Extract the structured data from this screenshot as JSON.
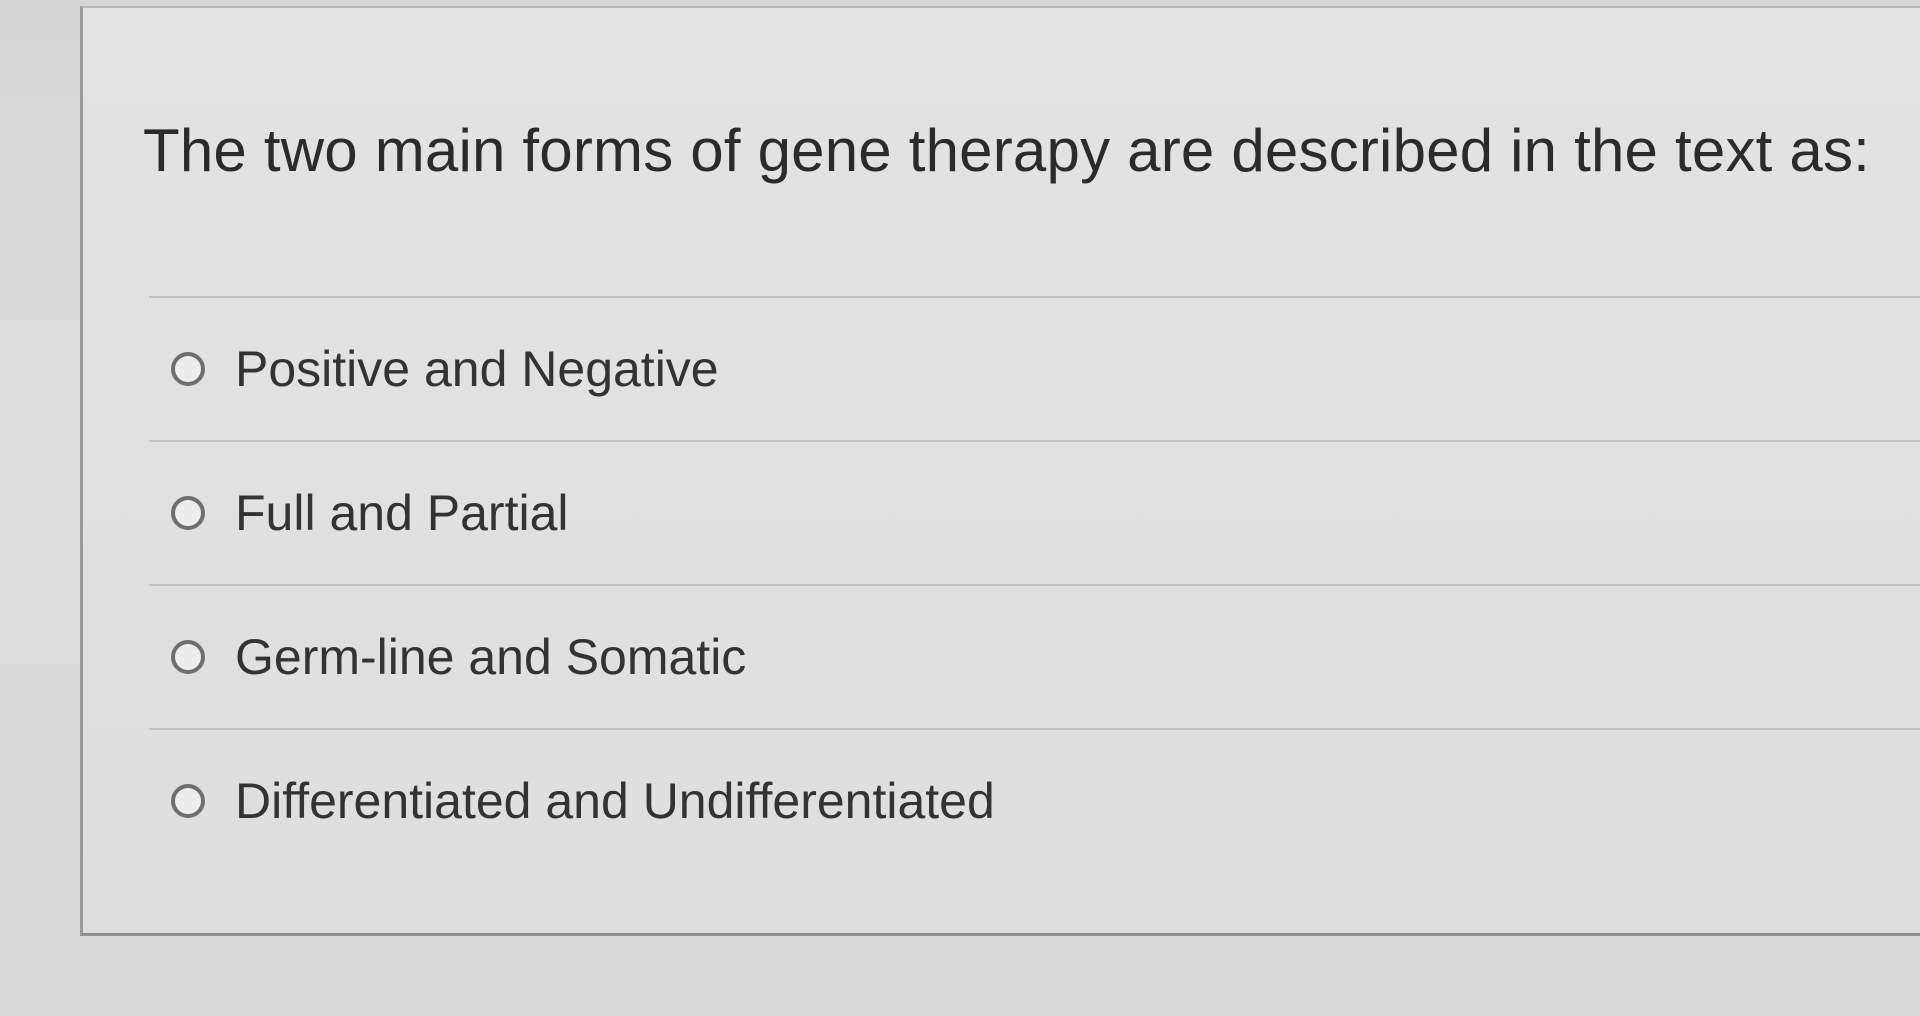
{
  "question": {
    "text": "The two main forms of gene therapy are described in the text as:"
  },
  "options": [
    {
      "label": "Positive and Negative",
      "selected": false
    },
    {
      "label": "Full and Partial",
      "selected": false
    },
    {
      "label": "Germ-line and Somatic",
      "selected": false
    },
    {
      "label": "Differentiated and Undifferentiated",
      "selected": false
    }
  ]
}
